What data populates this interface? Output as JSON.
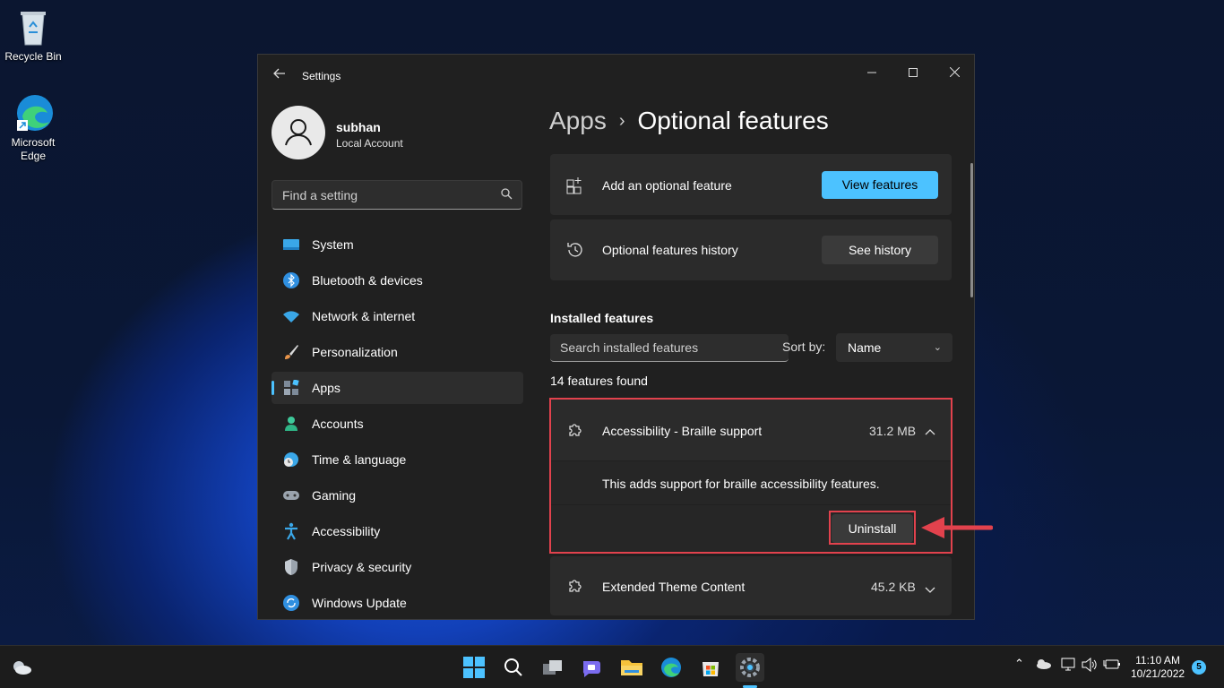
{
  "desktop": {
    "recycle_bin": "Recycle Bin",
    "edge_line1": "Microsoft",
    "edge_line2": "Edge"
  },
  "window": {
    "title": "Settings",
    "back_icon": "back-arrow-icon",
    "controls": [
      "minimize-icon",
      "maximize-icon",
      "close-icon"
    ]
  },
  "user": {
    "name": "subhan",
    "account_type": "Local Account"
  },
  "search": {
    "placeholder": "Find a setting"
  },
  "nav": [
    {
      "label": "System",
      "icon": "system-icon",
      "selected": false
    },
    {
      "label": "Bluetooth & devices",
      "icon": "bluetooth-icon",
      "selected": false
    },
    {
      "label": "Network & internet",
      "icon": "wifi-icon",
      "selected": false
    },
    {
      "label": "Personalization",
      "icon": "brush-icon",
      "selected": false
    },
    {
      "label": "Apps",
      "icon": "apps-icon",
      "selected": true
    },
    {
      "label": "Accounts",
      "icon": "accounts-icon",
      "selected": false
    },
    {
      "label": "Time & language",
      "icon": "globe-clock-icon",
      "selected": false
    },
    {
      "label": "Gaming",
      "icon": "gamepad-icon",
      "selected": false
    },
    {
      "label": "Accessibility",
      "icon": "accessibility-icon",
      "selected": false
    },
    {
      "label": "Privacy & security",
      "icon": "shield-icon",
      "selected": false
    },
    {
      "label": "Windows Update",
      "icon": "update-icon",
      "selected": false
    }
  ],
  "breadcrumb": {
    "parent": "Apps",
    "separator": "›",
    "current": "Optional features"
  },
  "add_feature": {
    "label": "Add an optional feature",
    "button": "View features"
  },
  "history": {
    "label": "Optional features history",
    "button": "See history"
  },
  "installed": {
    "heading": "Installed features",
    "search_placeholder": "Search installed features",
    "sort_label": "Sort by:",
    "sort_value": "Name",
    "count_text": "14 features found"
  },
  "features": [
    {
      "name": "Accessibility - Braille support",
      "size": "31.2 MB",
      "expanded": true,
      "description": "This adds support for braille accessibility features.",
      "action": "Uninstall"
    },
    {
      "name": "Extended Theme Content",
      "size": "45.2 KB",
      "expanded": false
    }
  ],
  "taskbar": {
    "time": "11:10 AM",
    "date": "10/21/2022",
    "notification_count": "5"
  },
  "colors": {
    "accent": "#4cc2ff",
    "highlight": "#e2424d"
  }
}
